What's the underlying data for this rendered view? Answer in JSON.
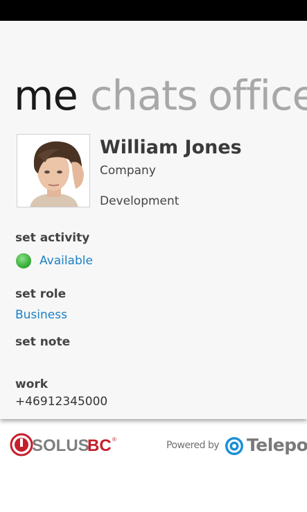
{
  "pivot": {
    "items": [
      "me",
      "chats",
      "office"
    ]
  },
  "profile": {
    "name": "William Jones",
    "company": "Company",
    "department": "Development"
  },
  "activity": {
    "label": "set activity",
    "value": "Available",
    "status_color": "#3fb43f"
  },
  "role": {
    "label": "set role",
    "value": "Business"
  },
  "note": {
    "label": "set note"
  },
  "work": {
    "label": "work",
    "phone": "+46912345000"
  },
  "footer": {
    "brand_left": "SOLUSBC",
    "powered_by": "Powered by",
    "brand_right": "Telepo"
  },
  "colors": {
    "accent": "#1b80c4",
    "panel_bg": "#f7f7f7"
  }
}
